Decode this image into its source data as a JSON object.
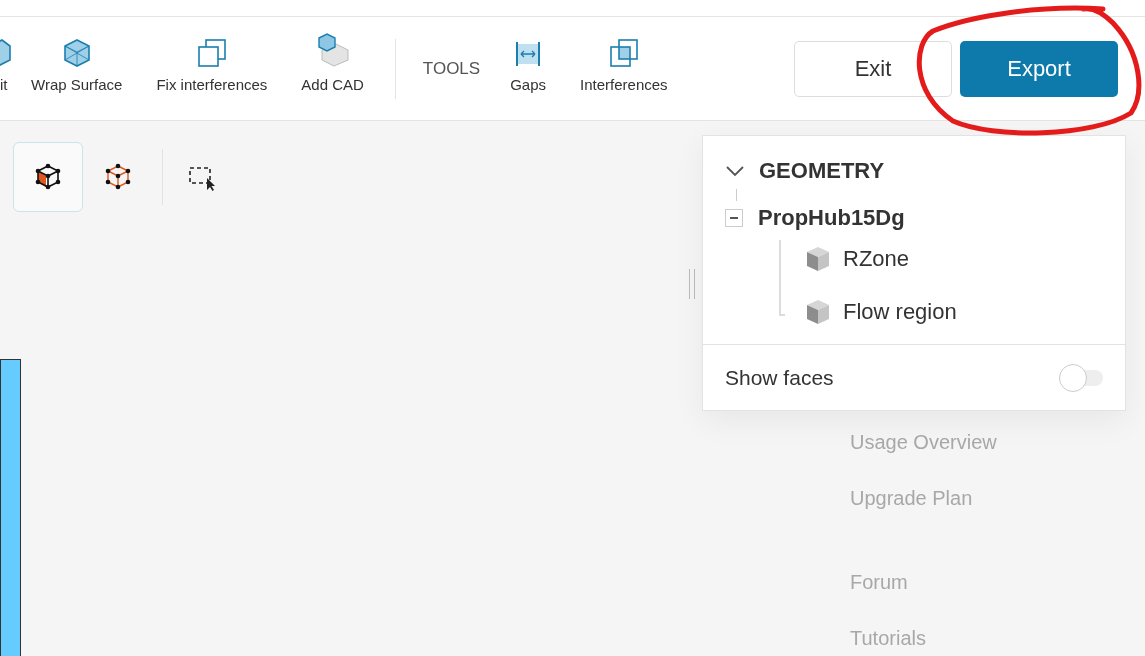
{
  "toolbar": {
    "items": [
      {
        "label": "it",
        "kind": "partial"
      },
      {
        "label": "Wrap Surface",
        "kind": "wrap"
      },
      {
        "label": "Fix interferences",
        "kind": "fix"
      },
      {
        "label": "Add CAD",
        "kind": "add"
      }
    ],
    "section_label": "TOOLS",
    "tools": [
      {
        "label": "Gaps",
        "kind": "gaps"
      },
      {
        "label": "Interferences",
        "kind": "interferences"
      }
    ],
    "buttons": [
      {
        "label": "Exit",
        "kind": "secondary"
      },
      {
        "label": "Export",
        "kind": "primary"
      }
    ]
  },
  "view_modes": [
    {
      "kind": "solid",
      "selected": true
    },
    {
      "kind": "wireframe",
      "selected": false
    },
    {
      "kind": "box_select",
      "selected": false
    }
  ],
  "tree": {
    "title": "GEOMETRY",
    "expanded": true,
    "root": {
      "label": "PropHub15Dg",
      "expanded": true,
      "children": [
        {
          "label": "RZone"
        },
        {
          "label": "Flow region"
        }
      ]
    }
  },
  "show_faces": {
    "label": "Show faces",
    "on": false
  },
  "background_menu": [
    "Usage Overview",
    "Upgrade Plan",
    "Forum",
    "Tutorials"
  ]
}
